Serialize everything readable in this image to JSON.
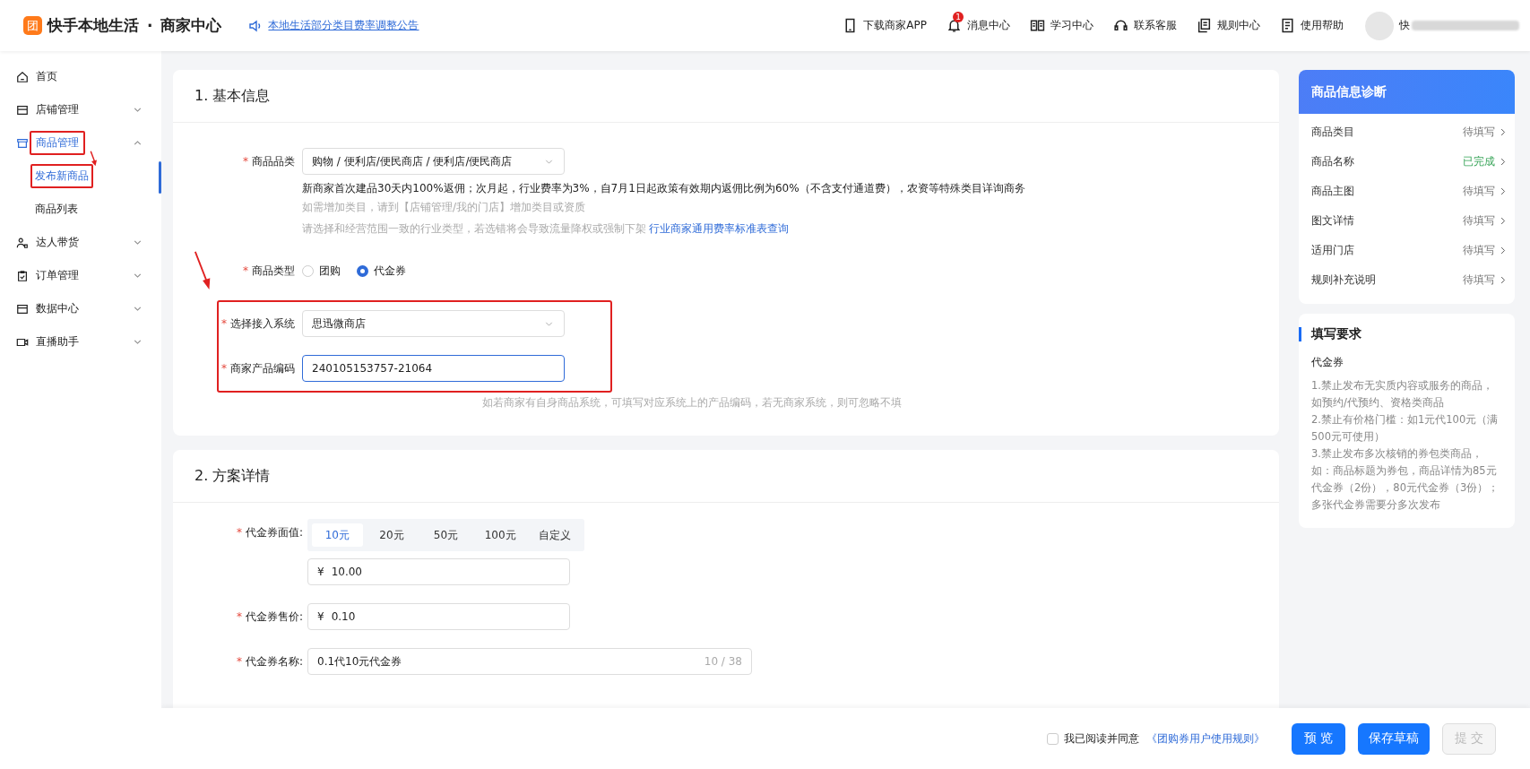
{
  "header": {
    "logo_mark": "团",
    "brand": "快手本地生活",
    "separator": "·",
    "subtitle": "商家中心",
    "notice": "本地生活部分类目费率调整公告",
    "nav": [
      {
        "label": "下载商家APP"
      },
      {
        "label": "消息中心",
        "badge": "1"
      },
      {
        "label": "学习中心"
      },
      {
        "label": "联系客服"
      },
      {
        "label": "规则中心"
      },
      {
        "label": "使用帮助"
      }
    ],
    "user": {
      "name": "快"
    }
  },
  "sidebar": {
    "items": [
      {
        "label": "首页"
      },
      {
        "label": "店铺管理",
        "expanded": false
      },
      {
        "label": "商品管理",
        "expanded": true,
        "highlighted": true,
        "children": [
          {
            "label": "发布新商品",
            "selected": true,
            "highlighted": true
          },
          {
            "label": "商品列表",
            "selected": false,
            "highlighted": false
          }
        ]
      },
      {
        "label": "达人带货",
        "expanded": false
      },
      {
        "label": "订单管理",
        "expanded": false
      },
      {
        "label": "数据中心",
        "expanded": false
      },
      {
        "label": "直播助手",
        "expanded": false
      }
    ]
  },
  "basic": {
    "title": "1. 基本信息",
    "category": {
      "mark": "*",
      "label": "商品品类",
      "value": "购物 / 便利店/便民商店 / 便利店/便民商店",
      "note": "新商家首次建品30天内100%返佣；次月起，行业费率为3%，自7月1日起政策有效期内返佣比例为60%（不含支付通道费），农资等特殊类目详询商务",
      "hint": "如需增加类目，请到【店铺管理/我的门店】增加类目或资质",
      "warning": "请选择和经营范围一致的行业类型，若选错将会导致流量降权或强制下架",
      "link": "行业商家通用费率标准表查询"
    },
    "product_type": {
      "mark": "*",
      "label": "商品类型",
      "options": [
        {
          "label": "团购",
          "selected": false
        },
        {
          "label": "代金券",
          "selected": true
        }
      ]
    },
    "integration": {
      "highlighted": true,
      "system": {
        "mark": "*",
        "label": "选择接入系统",
        "value": "思迅微商店"
      },
      "code": {
        "mark": "*",
        "label": "商家产品编码",
        "value": "240105153757-21064"
      }
    },
    "code_hint": "如若商家有自身商品系统，可填写对应系统上的产品编码，若无商家系统，则可忽略不填"
  },
  "plan": {
    "title": "2. 方案详情",
    "face_value": {
      "mark": "*",
      "label": "代金券面值:",
      "options": [
        {
          "label": "10元",
          "selected": true
        },
        {
          "label": "20元",
          "selected": false
        },
        {
          "label": "50元",
          "selected": false
        },
        {
          "label": "100元",
          "selected": false
        },
        {
          "label": "自定义",
          "selected": false
        }
      ],
      "currency": "¥",
      "value": "10.00"
    },
    "price": {
      "mark": "*",
      "label": "代金券售价:",
      "currency": "¥",
      "value": "0.10"
    },
    "name": {
      "mark": "*",
      "label": "代金券名称:",
      "value": "0.1代10元代金券",
      "counter": "10 / 38"
    }
  },
  "diagnosis": {
    "title": "商品信息诊断",
    "rows": [
      {
        "label": "商品类目",
        "status": "待填写",
        "done": false
      },
      {
        "label": "商品名称",
        "status": "已完成",
        "done": true
      },
      {
        "label": "商品主图",
        "status": "待填写",
        "done": false
      },
      {
        "label": "图文详情",
        "status": "待填写",
        "done": false
      },
      {
        "label": "适用门店",
        "status": "待填写",
        "done": false
      },
      {
        "label": "规则补充说明",
        "status": "待填写",
        "done": false
      }
    ]
  },
  "requirements": {
    "title": "填写要求",
    "subtitle": "代金券",
    "rules": [
      "1.禁止发布无实质内容或服务的商品，如预约/代预约、资格类商品",
      "2.禁止有价格门槛：如1元代100元（满500元可使用）",
      "3.禁止发布多次核销的券包类商品，如：商品标题为券包，商品详情为85元代金券（2份），80元代金券（3份）；多张代金券需要分多次发布"
    ]
  },
  "footer": {
    "agree": {
      "label": "我已阅读并同意",
      "checked": false
    },
    "rules_link": "《团购券用户使用规则》",
    "buttons": [
      {
        "label": "预 览",
        "disabled": false
      },
      {
        "label": "保存草稿",
        "disabled": false
      },
      {
        "label": "提 交",
        "disabled": true
      }
    ]
  }
}
